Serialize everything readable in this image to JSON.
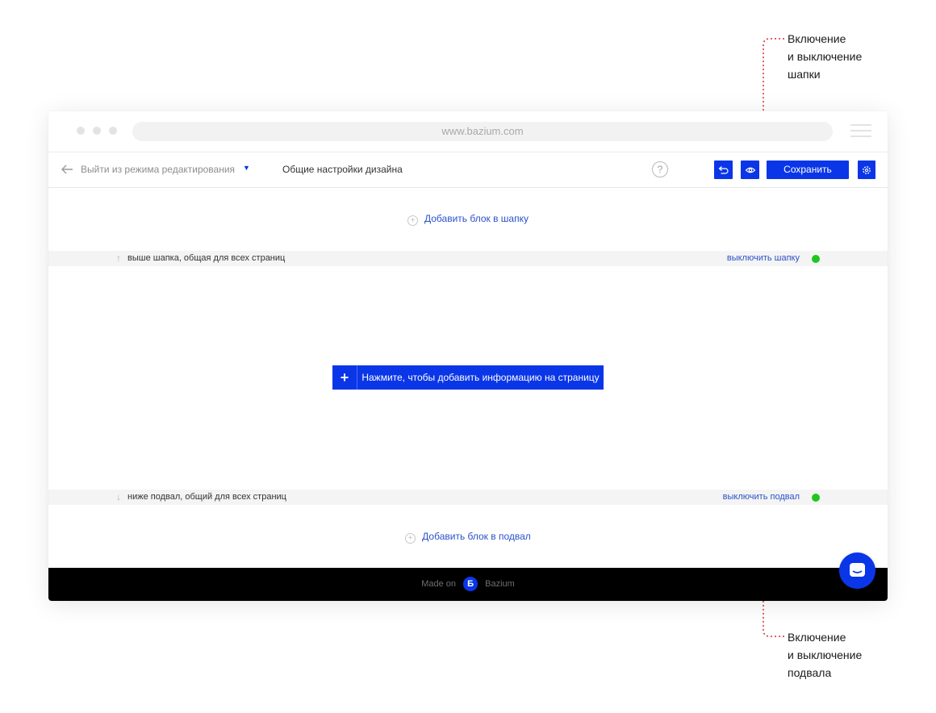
{
  "annotations": {
    "header_toggle": [
      "Включение",
      "и выключение",
      "шапки"
    ],
    "footer_toggle": [
      "Включение",
      "и выключение",
      "подвала"
    ]
  },
  "browser": {
    "url": "www.bazium.com"
  },
  "toolbar": {
    "exit_label": "Выйти из режима редактирования",
    "design_settings": "Общие настройки дизайна",
    "help": "?",
    "save_label": "Сохранить"
  },
  "header_area": {
    "add_block": "Добавить блок в шапку",
    "strip_arrow": "↑",
    "strip_label": "выше шапка, общая для всех страниц",
    "toggle_label": "выключить шапку"
  },
  "content": {
    "add_plus": "+",
    "add_info": "Нажмите, чтобы добавить информацию на страницу"
  },
  "footer_area": {
    "strip_arrow": "↓",
    "strip_label": "ниже подвал, общий для всех страниц",
    "toggle_label": "выключить подвал",
    "add_block": "Добавить блок в подвал"
  },
  "site_footer": {
    "made_on": "Made on",
    "logo_letter": "Б",
    "brand": "Bazium"
  },
  "colors": {
    "accent": "#0a36e8",
    "link": "#2a52c9",
    "status_on": "#1ec71e",
    "annotation_line": "#d32f2f"
  }
}
